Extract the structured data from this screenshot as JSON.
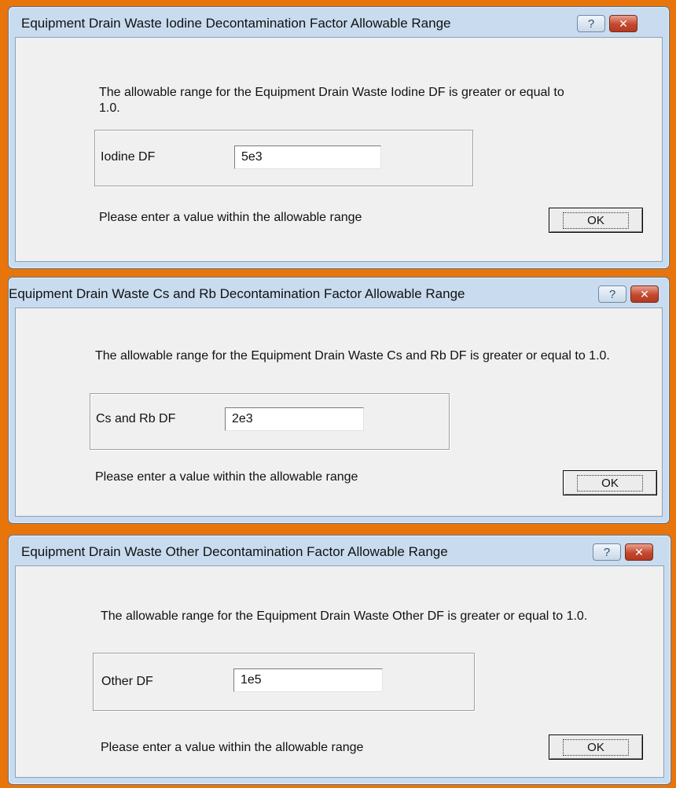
{
  "dialogs": [
    {
      "title": "Equipment Drain Waste Iodine Decontamination Factor Allowable Range",
      "help_glyph": "?",
      "close_glyph": "✕",
      "message": "The allowable range for the Equipment Drain Waste Iodine DF is greater or equal to 1.0.",
      "field_label": "Iodine DF",
      "field_value": "5e3",
      "prompt": "Please enter a value within the allowable range",
      "ok_label": "OK"
    },
    {
      "title": "Equipment Drain Waste Cs and Rb Decontamination Factor Allowable Range",
      "help_glyph": "?",
      "close_glyph": "✕",
      "message": "The allowable range for the Equipment Drain Waste Cs and Rb DF is greater or equal to 1.0.",
      "field_label": "Cs and Rb DF",
      "field_value": "2e3",
      "prompt": "Please enter a value within the allowable range",
      "ok_label": "OK"
    },
    {
      "title": "Equipment Drain Waste Other Decontamination Factor Allowable Range",
      "help_glyph": "?",
      "close_glyph": "✕",
      "message": "The allowable range for the Equipment Drain Waste Other DF is greater or equal to 1.0.",
      "field_label": "Other DF",
      "field_value": "1e5",
      "prompt": "Please enter a value within the allowable range",
      "ok_label": "OK"
    }
  ]
}
